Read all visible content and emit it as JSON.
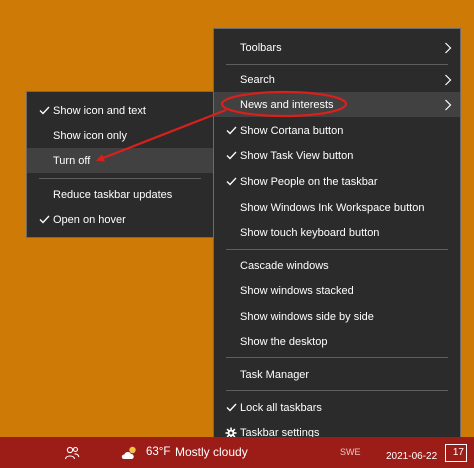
{
  "main_menu": {
    "toolbars": "Toolbars",
    "search": "Search",
    "news_and_interests": "News and interests",
    "show_cortana_button": "Show Cortana button",
    "show_task_view_button": "Show Task View button",
    "show_people": "Show People on the taskbar",
    "show_ink_workspace": "Show Windows Ink Workspace button",
    "show_touch_keyboard": "Show touch keyboard button",
    "cascade_windows": "Cascade windows",
    "show_windows_stacked": "Show windows stacked",
    "show_windows_side_by_side": "Show windows side by side",
    "show_desktop": "Show the desktop",
    "task_manager": "Task Manager",
    "lock_all_taskbars": "Lock all taskbars",
    "taskbar_settings": "Taskbar settings"
  },
  "sub_menu": {
    "show_icon_and_text": "Show icon and text",
    "show_icon_only": "Show icon only",
    "turn_off": "Turn off",
    "reduce_taskbar_updates": "Reduce taskbar updates",
    "open_on_hover": "Open on hover"
  },
  "taskbar": {
    "temperature": "63°F",
    "weather_condition": "Mostly cloudy",
    "language": "SWE",
    "date": "2021-06-22",
    "notification_count": "17"
  },
  "colors": {
    "desktop": "#cd7a06",
    "menu_bg": "#2b2b2b",
    "highlight": "#414141",
    "taskbar": "#9c1d18",
    "annotation": "#d8201c"
  },
  "icons": {
    "check": "checkmark-icon",
    "chevron": "chevron-right-icon",
    "gear": "gear-icon",
    "people": "people-icon",
    "weather": "cloud-sun-icon",
    "notification": "notification-icon"
  }
}
